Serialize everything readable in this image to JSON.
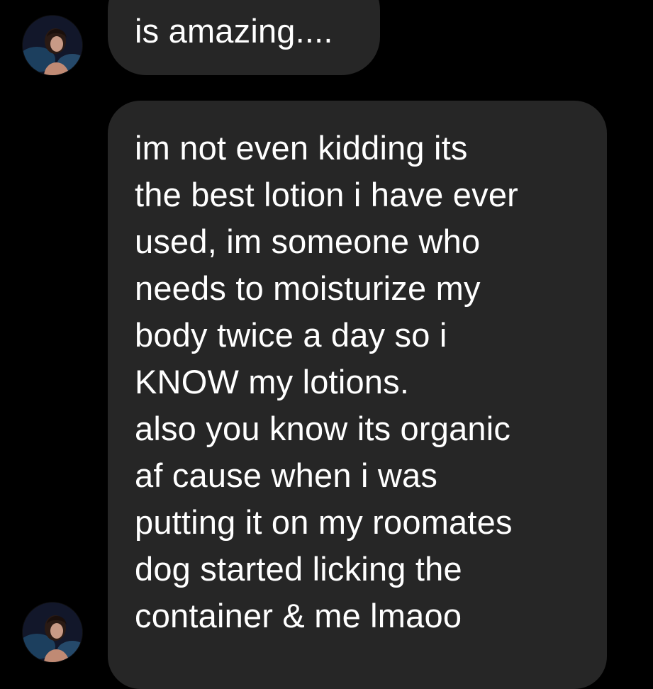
{
  "conversation": {
    "messages": [
      {
        "sender": "other",
        "text": "is amazing...."
      },
      {
        "sender": "other",
        "text": "im not even kidding its\nthe best lotion i have ever\nused, im someone who\nneeds to moisturize my\nbody twice a day so i\nKNOW my lotions.\nalso you know its organic\naf cause when i was\nputting it on my roomates\ndog started licking the\ncontainer & me lmaoo"
      }
    ]
  },
  "colors": {
    "background": "#000000",
    "bubble": "#262626",
    "text": "#ffffff"
  },
  "icons": {
    "avatar": "profile-photo"
  }
}
